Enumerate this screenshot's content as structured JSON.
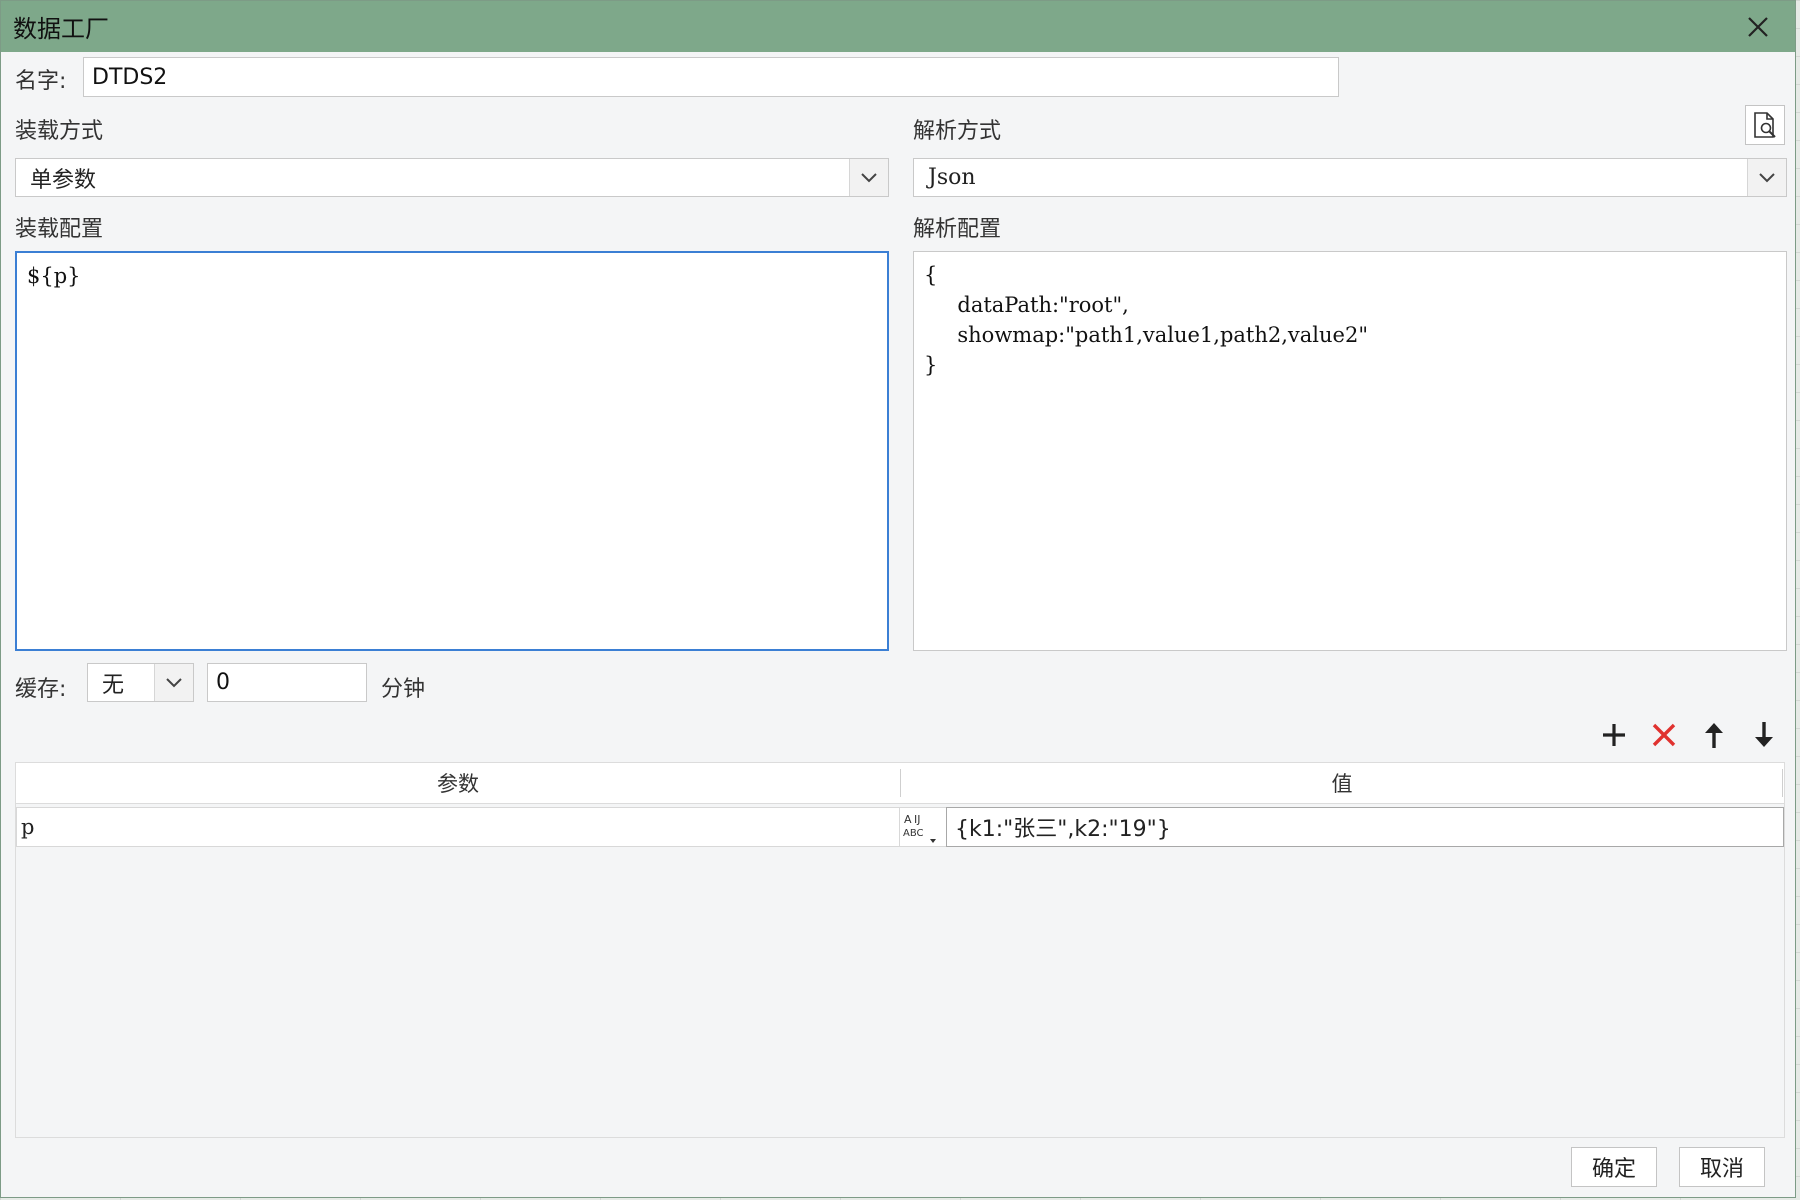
{
  "dialog": {
    "title": "数据工厂"
  },
  "name": {
    "label": "名字:",
    "value": "DTDS2"
  },
  "load": {
    "method_label": "装载方式",
    "method_value": "单参数",
    "config_label": "装载配置",
    "config_text": "${p}"
  },
  "parse": {
    "method_label": "解析方式",
    "method_value": "Json",
    "config_label": "解析配置",
    "config_text": "{\n     dataPath:\"root\",\n     showmap:\"path1,value1,path2,value2\"\n}"
  },
  "cache": {
    "label": "缓存:",
    "mode_value": "无",
    "duration_value": "0",
    "unit": "分钟"
  },
  "toolbar": {
    "icons": [
      "add-icon",
      "delete-icon",
      "arrow-up-icon",
      "arrow-down-icon"
    ],
    "delete_color": "#e0322f"
  },
  "table": {
    "headers": [
      "参数",
      "值"
    ],
    "rows": [
      {
        "param": "p",
        "value": "{k1:\"张三\",k2:\"19\"}"
      }
    ]
  },
  "buttons": {
    "ok": "确定",
    "cancel": "取消"
  },
  "colors": {
    "titlebar": "#7ea88a",
    "focus_border": "#3b7fd4"
  }
}
